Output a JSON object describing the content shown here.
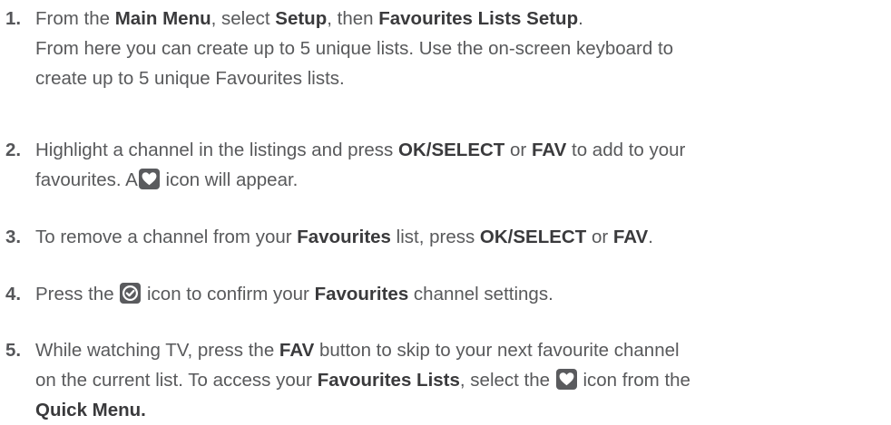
{
  "steps": [
    {
      "number": "1.",
      "lines": [
        [
          {
            "t": "From the "
          },
          {
            "t": "Main Menu",
            "b": true
          },
          {
            "t": ", select "
          },
          {
            "t": "Setup",
            "b": true
          },
          {
            "t": ", then "
          },
          {
            "t": "Favourites Lists Setup",
            "b": true
          },
          {
            "t": "."
          }
        ],
        [
          {
            "t": "From here you can create up to 5 unique lists. Use the on-screen keyboard to"
          }
        ],
        [
          {
            "t": "create up to 5 unique Favourites lists."
          }
        ]
      ]
    },
    {
      "number": "2.",
      "lines": [
        [
          {
            "t": "Highlight a channel in the listings and press "
          },
          {
            "t": "OK/SELECT",
            "b": true
          },
          {
            "t": " or "
          },
          {
            "t": "FAV",
            "b": true
          },
          {
            "t": " to add to your"
          }
        ],
        [
          {
            "t": "favourites. A"
          },
          {
            "icon": "heart-icon"
          },
          {
            "t": " icon will appear."
          }
        ]
      ]
    },
    {
      "number": "3.",
      "lines": [
        [
          {
            "t": "To remove a channel from your "
          },
          {
            "t": "Favourites",
            "b": true
          },
          {
            "t": " list, press "
          },
          {
            "t": "OK/SELECT",
            "b": true
          },
          {
            "t": " or "
          },
          {
            "t": "FAV",
            "b": true
          },
          {
            "t": "."
          }
        ]
      ]
    },
    {
      "number": "4.",
      "lines": [
        [
          {
            "t": "Press the "
          },
          {
            "icon": "check-circle-icon"
          },
          {
            "t": " icon to confirm your "
          },
          {
            "t": "Favourites",
            "b": true
          },
          {
            "t": " channel settings."
          }
        ]
      ]
    },
    {
      "number": "5.",
      "lines": [
        [
          {
            "t": "While watching TV, press the "
          },
          {
            "t": "FAV",
            "b": true
          },
          {
            "t": " button to skip to your next favourite channel"
          }
        ],
        [
          {
            "t": "on the current list. To access your "
          },
          {
            "t": "Favourites Lists",
            "b": true
          },
          {
            "t": ", select the "
          },
          {
            "icon": "heart-icon"
          },
          {
            "t": " icon from the"
          }
        ],
        [
          {
            "t": "Quick Menu.",
            "b": true
          }
        ]
      ]
    }
  ],
  "colors": {
    "text": "#58595b",
    "bold": "#3a3a3c",
    "icon_bg": "#5a5b5e",
    "icon_fg": "#ffffff"
  }
}
